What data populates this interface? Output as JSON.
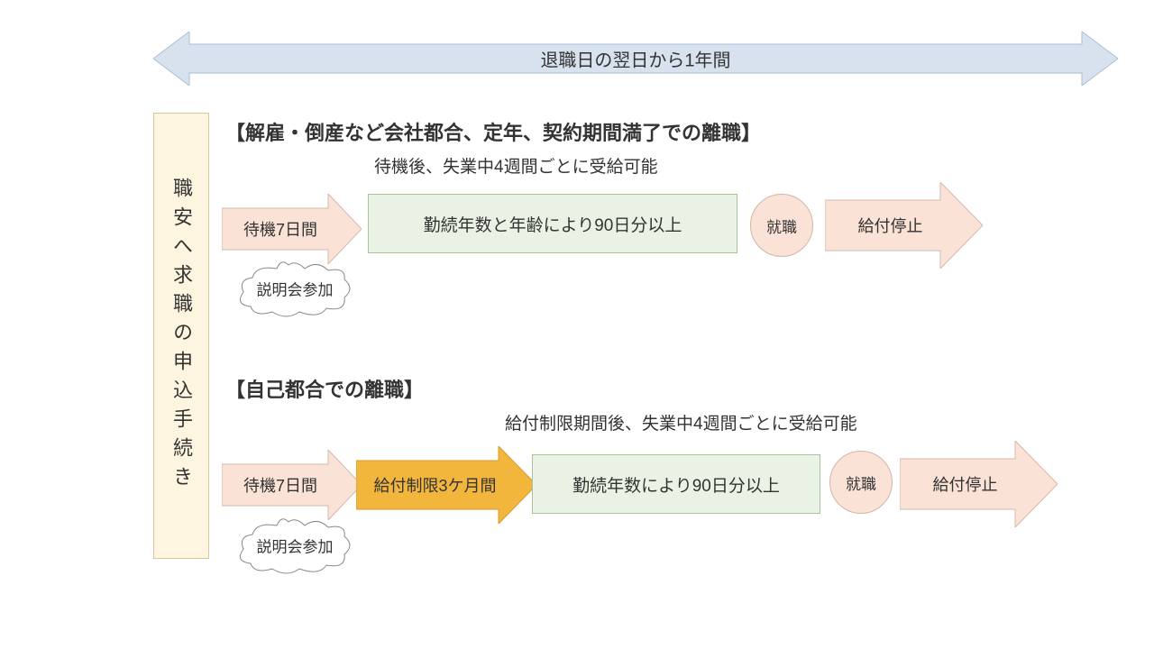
{
  "topArrow": {
    "label": "退職日の翌日から1年間"
  },
  "leftBox": {
    "label": "職安へ求職の申込手続き"
  },
  "section1": {
    "title": "【解雇・倒産など会社都合、定年、契約期間満了での離職】",
    "subtitle": "待機後、失業中4週間ごとに受給可能",
    "wait": "待機7日間",
    "bubble": "説明会参加",
    "box": "勤続年数と年齢により90日分以上",
    "circle": "就職",
    "stop": "給付停止"
  },
  "section2": {
    "title": "【自己都合での離職】",
    "subtitle": "給付制限期間後、失業中4週間ごとに受給可能",
    "wait": "待機7日間",
    "bubble": "説明会参加",
    "limit": "給付制限3ケ月間",
    "box": "勤続年数により90日分以上",
    "circle": "就職",
    "stop": "給付停止"
  },
  "colors": {
    "blueArrowFill": "#d8e2ef",
    "blueArrowStroke": "#a9bdd4",
    "peachFill": "#fae2d7",
    "peachStroke": "#d4b9ab",
    "orangeFill": "#f3b63c",
    "orangeStroke": "#d49a2a"
  }
}
